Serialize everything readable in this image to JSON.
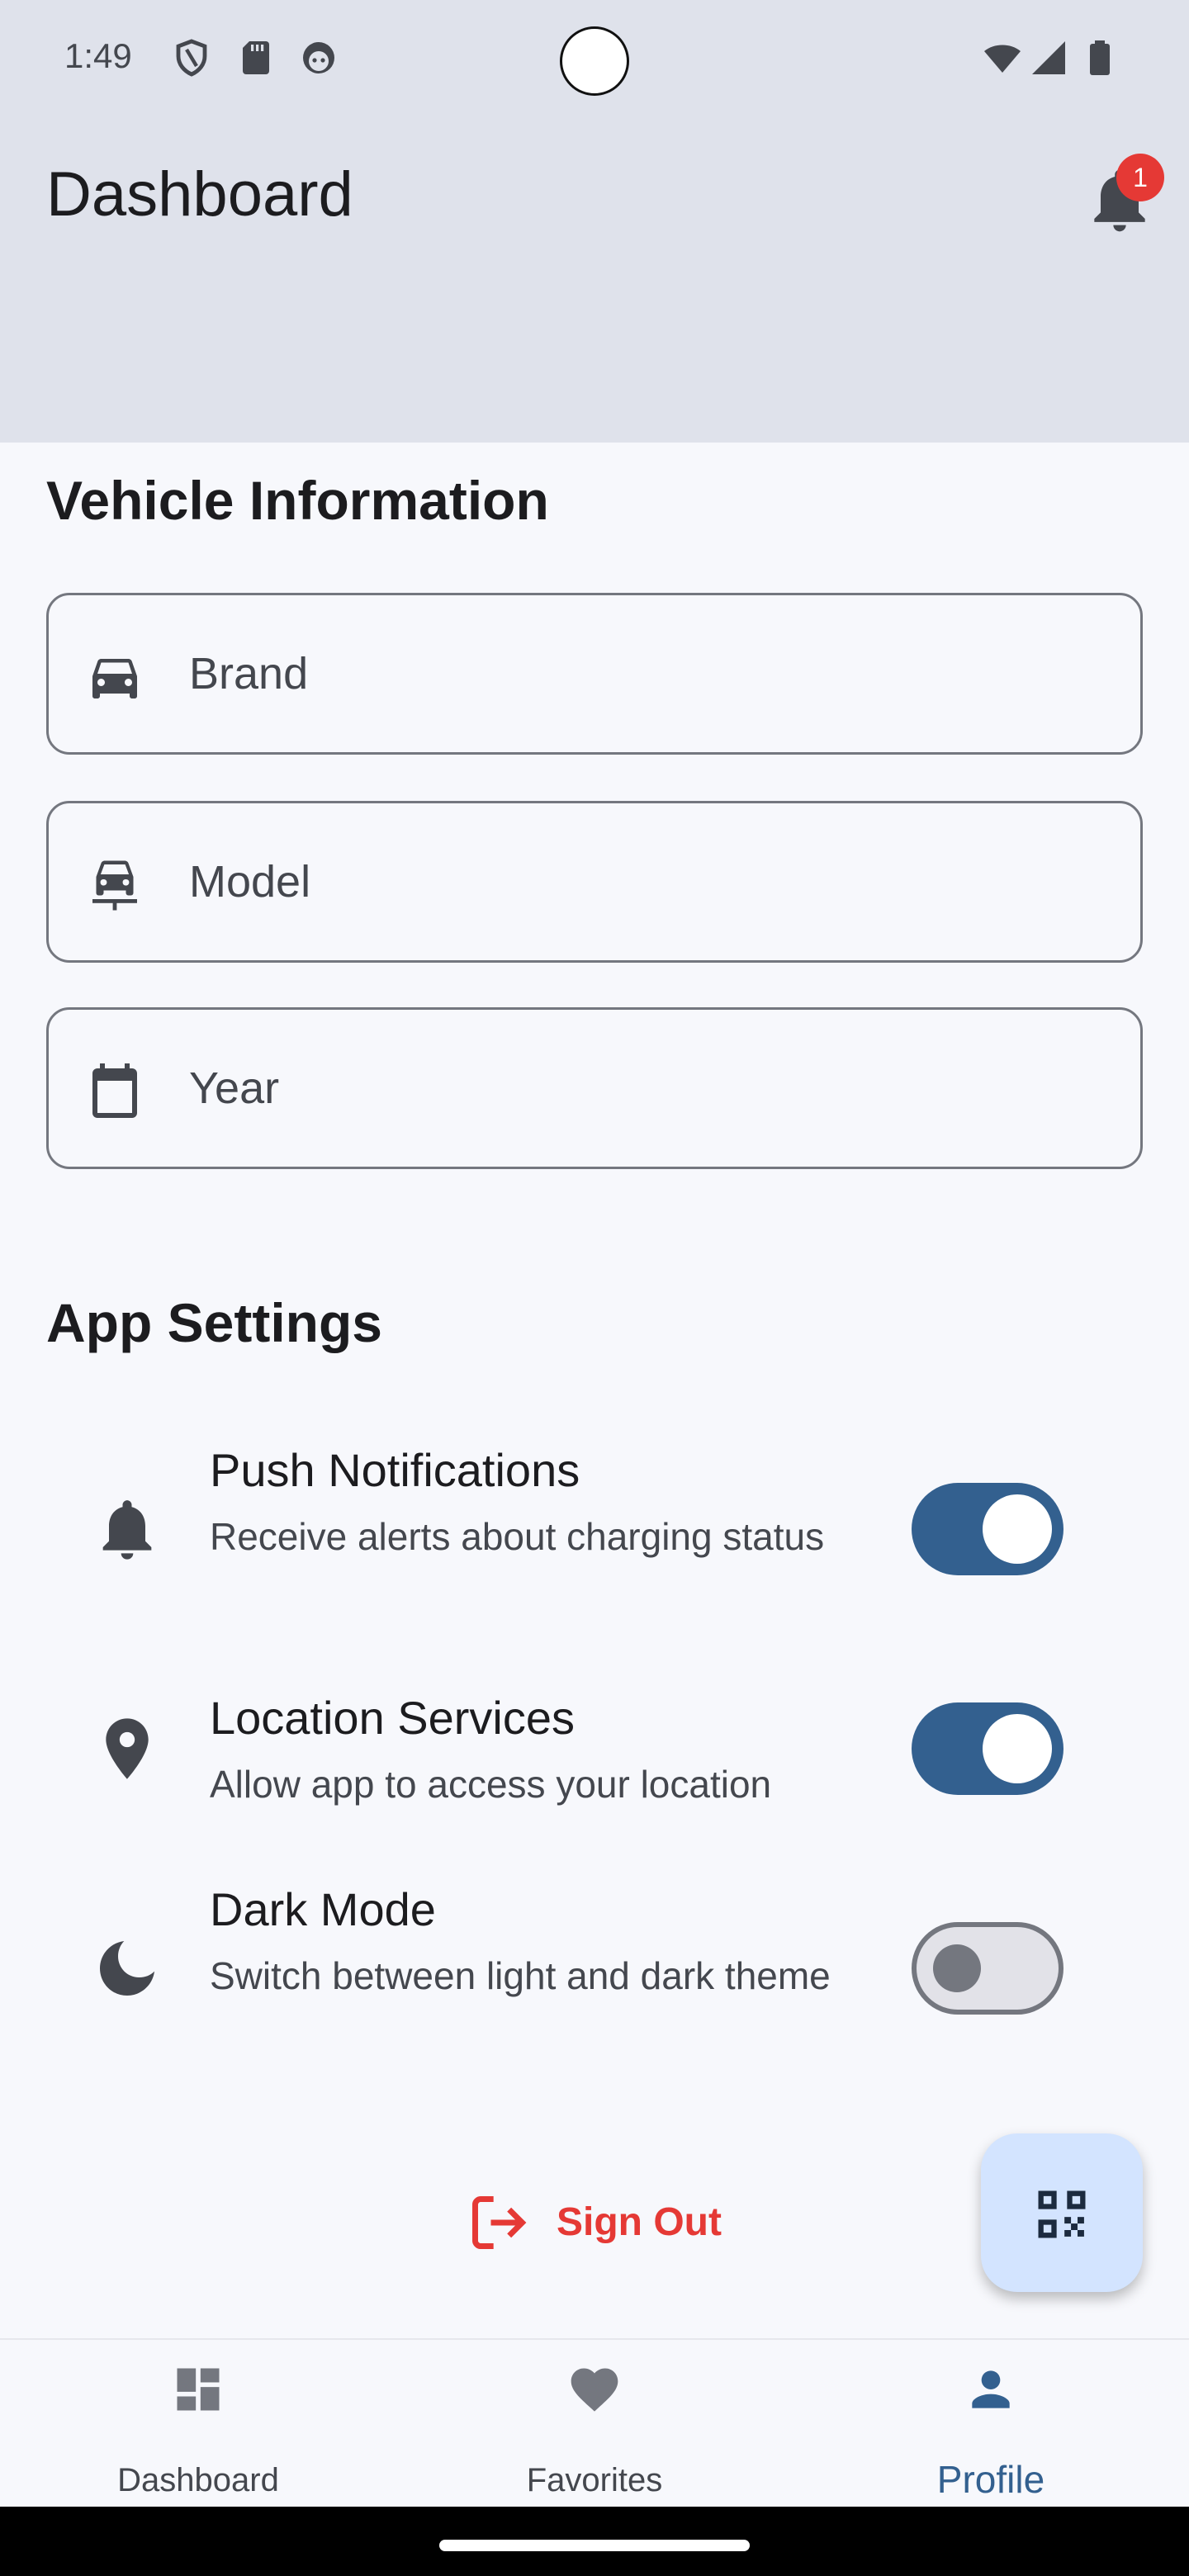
{
  "status_bar": {
    "time": "1:49"
  },
  "header": {
    "title": "Dashboard",
    "notification_count": "1"
  },
  "vehicle_section": {
    "title": "Vehicle Information",
    "fields": [
      {
        "icon": "car-icon",
        "placeholder": "Brand"
      },
      {
        "icon": "car-front-icon",
        "placeholder": "Model"
      },
      {
        "icon": "calendar-icon",
        "placeholder": "Year"
      }
    ]
  },
  "settings_section": {
    "title": "App Settings",
    "items": [
      {
        "icon": "bell-icon",
        "title": "Push Notifications",
        "description": "Receive alerts about charging status",
        "enabled": true
      },
      {
        "icon": "location-pin-icon",
        "title": "Location Services",
        "description": "Allow app to access your location",
        "enabled": true
      },
      {
        "icon": "moon-icon",
        "title": "Dark Mode",
        "description": "Switch between light and dark theme",
        "enabled": false
      }
    ]
  },
  "sign_out": {
    "label": "Sign Out",
    "color": "#e53935"
  },
  "fab": {
    "icon": "qr-code-icon"
  },
  "bottom_nav": {
    "items": [
      {
        "label": "Dashboard",
        "icon": "dashboard-icon",
        "active": false
      },
      {
        "label": "Favorites",
        "icon": "heart-icon",
        "active": false
      },
      {
        "label": "Profile",
        "icon": "person-icon",
        "active": true
      }
    ]
  },
  "colors": {
    "primary": "#33608f",
    "header_bg": "#dfe2eb",
    "page_bg": "#f7f8fc",
    "fab_bg": "#d3e4ff",
    "danger": "#e53935"
  }
}
